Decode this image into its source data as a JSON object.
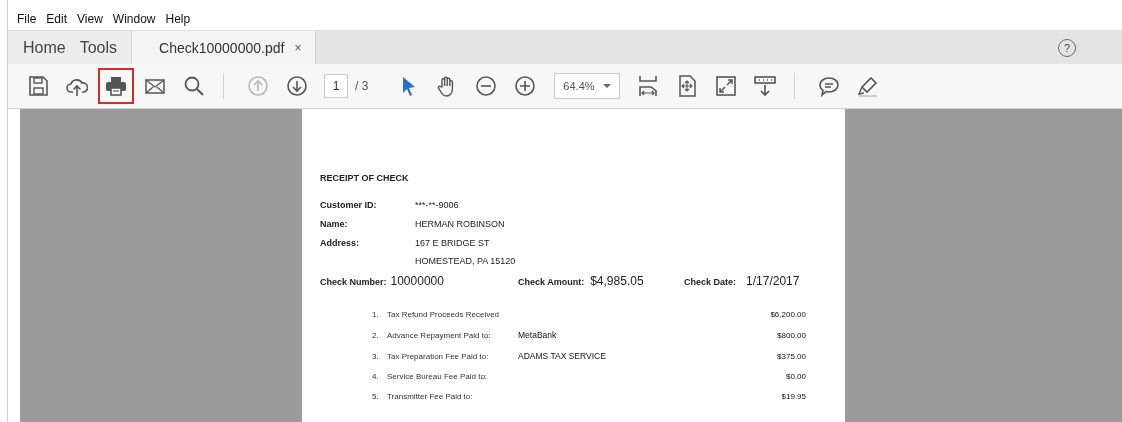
{
  "menu": [
    "File",
    "Edit",
    "View",
    "Window",
    "Help"
  ],
  "tabs": [
    {
      "label": "Home",
      "selected": false
    },
    {
      "label": "Tools",
      "selected": false
    }
  ],
  "document_tab": {
    "label": "Check10000000.pdf",
    "close": "×",
    "selected": true
  },
  "help": "?",
  "toolbar": [
    {
      "kind": "tool",
      "disabled": false,
      "highlighted": false,
      "selected": false
    },
    {
      "kind": "tool",
      "disabled": false,
      "highlighted": false,
      "selected": false
    },
    {
      "kind": "tool",
      "disabled": false,
      "highlighted": true,
      "selected": false
    },
    {
      "kind": "tool",
      "disabled": false,
      "highlighted": false,
      "selected": false
    },
    {
      "kind": "tool",
      "disabled": false,
      "highlighted": false,
      "selected": false
    },
    {
      "kind": "separator"
    },
    {
      "kind": "tool",
      "disabled": true,
      "highlighted": false,
      "selected": false
    },
    {
      "kind": "tool",
      "disabled": false,
      "highlighted": false,
      "selected": false
    },
    {
      "kind": "page",
      "value": "1",
      "total": "/ 3"
    },
    {
      "kind": "tool",
      "disabled": false,
      "highlighted": false,
      "selected": true
    },
    {
      "kind": "tool",
      "disabled": false,
      "highlighted": false,
      "selected": false
    },
    {
      "kind": "tool",
      "disabled": false,
      "highlighted": false,
      "selected": false
    },
    {
      "kind": "tool",
      "disabled": false,
      "highlighted": false,
      "selected": false
    },
    {
      "kind": "zoom",
      "value": "64.4%"
    },
    {
      "kind": "tool",
      "disabled": false,
      "highlighted": false,
      "selected": false
    },
    {
      "kind": "tool",
      "disabled": false,
      "highlighted": false,
      "selected": false
    },
    {
      "kind": "tool",
      "disabled": false,
      "highlighted": false,
      "selected": false
    },
    {
      "kind": "tool",
      "disabled": false,
      "highlighted": false,
      "selected": false
    },
    {
      "kind": "separator"
    },
    {
      "kind": "tool",
      "disabled": false,
      "highlighted": false,
      "selected": false
    },
    {
      "kind": "tool",
      "disabled": false,
      "highlighted": false,
      "selected": false
    }
  ],
  "document": {
    "title": "RECEIPT OF CHECK",
    "fields": [
      {
        "label": "Customer ID:",
        "lines": [
          "***-**-9006"
        ]
      },
      {
        "label": "Name:",
        "lines": [
          "HERMAN ROBINSON"
        ]
      },
      {
        "label": "Address:",
        "lines": [
          "167 E BRIDGE ST",
          "HOMESTEAD, PA 15120"
        ]
      }
    ],
    "check": [
      {
        "label": "Check Number:",
        "value": "10000000"
      },
      {
        "label": "Check Amount:",
        "value": "$4,985.05"
      },
      {
        "label": "Check Date:",
        "value": "1/17/2017"
      }
    ],
    "items": [
      {
        "number": "1.",
        "label": "Tax Refund Proceeds Received",
        "amount": "$6,200.00"
      },
      {
        "number": "2.",
        "label": "Advance Repayment Paid to:",
        "payee": "MetaBank",
        "amount": "$800.00"
      },
      {
        "number": "3.",
        "label": "Tax Preparation Fee Paid to:",
        "payee": "ADAMS TAX SERVICE",
        "amount": "$375.00"
      },
      {
        "number": "4.",
        "label": "Service Bureau Fee Paid to:",
        "amount": "$0.00"
      },
      {
        "number": "5.",
        "label": "Transmitter Fee Paid to:",
        "amount": "$19.95"
      }
    ]
  }
}
